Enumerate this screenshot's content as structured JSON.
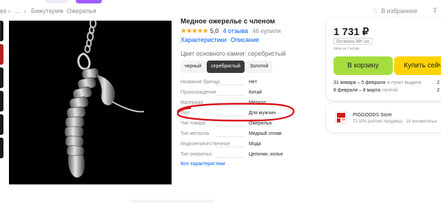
{
  "topbar": {
    "accent_color": "#a05cff"
  },
  "breadcrumb": {
    "items": [
      "es",
      "...",
      "Бижутерия",
      "Ожерелья"
    ],
    "separator": "›"
  },
  "header_actions": {
    "favorite_label": "В избранное",
    "favorite_icon": "heart-icon",
    "share_icon": "share-icon"
  },
  "product": {
    "title": "Медное ожерелье с членом",
    "stars": "★★★★★",
    "rating": "5,0",
    "reviews": "4 отзыва",
    "bought": "46 купили",
    "tab_specs": "Характеристики",
    "tab_description": "Описание",
    "color_label": "Цвет основного камня: серебристый",
    "color_options": [
      "черный",
      "серебристый",
      "Золотой"
    ],
    "selected_color": "серебристый"
  },
  "specs": {
    "rows": [
      {
        "key": "Название бренда",
        "value": "Нет"
      },
      {
        "key": "Происхождение",
        "value": "Китай"
      },
      {
        "key": "Материал",
        "value": "Металл"
      },
      {
        "key": "Пол",
        "value": "Для мужчин"
      },
      {
        "key": "Тип товара",
        "value": "Ожерелья"
      },
      {
        "key": "Тип металла",
        "value": "Медный сплав"
      },
      {
        "key": "Модное/качественное",
        "value": "Мода"
      },
      {
        "key": "Тип ожерелья",
        "value": "Цепочки, колье"
      }
    ],
    "all_link": "Все характеристики"
  },
  "annotation": {
    "color": "#d8141b",
    "highlights_row": "Пол"
  },
  "buybox": {
    "price": "1 731 ₽",
    "stock": "Осталось 99+ шт.",
    "per_unit": "Цена за 1 штуку",
    "cart_button": "В корзину",
    "buy_button": "Купить сейчас",
    "cart_color": "#a6dd3e",
    "buy_color": "#ffd300",
    "delivery": [
      {
        "when": "31 января – 5 февраля",
        "where": "в пункт выдачи",
        "count": "2"
      },
      {
        "when": "8 февраля – 8 марта",
        "where": "почтой",
        "count": "2"
      }
    ]
  },
  "seller": {
    "name": "PIGGOODS Store",
    "meta": "73,33% рейтинг продавца · 18 положительн",
    "logo_icon": "store-logo-icon"
  }
}
